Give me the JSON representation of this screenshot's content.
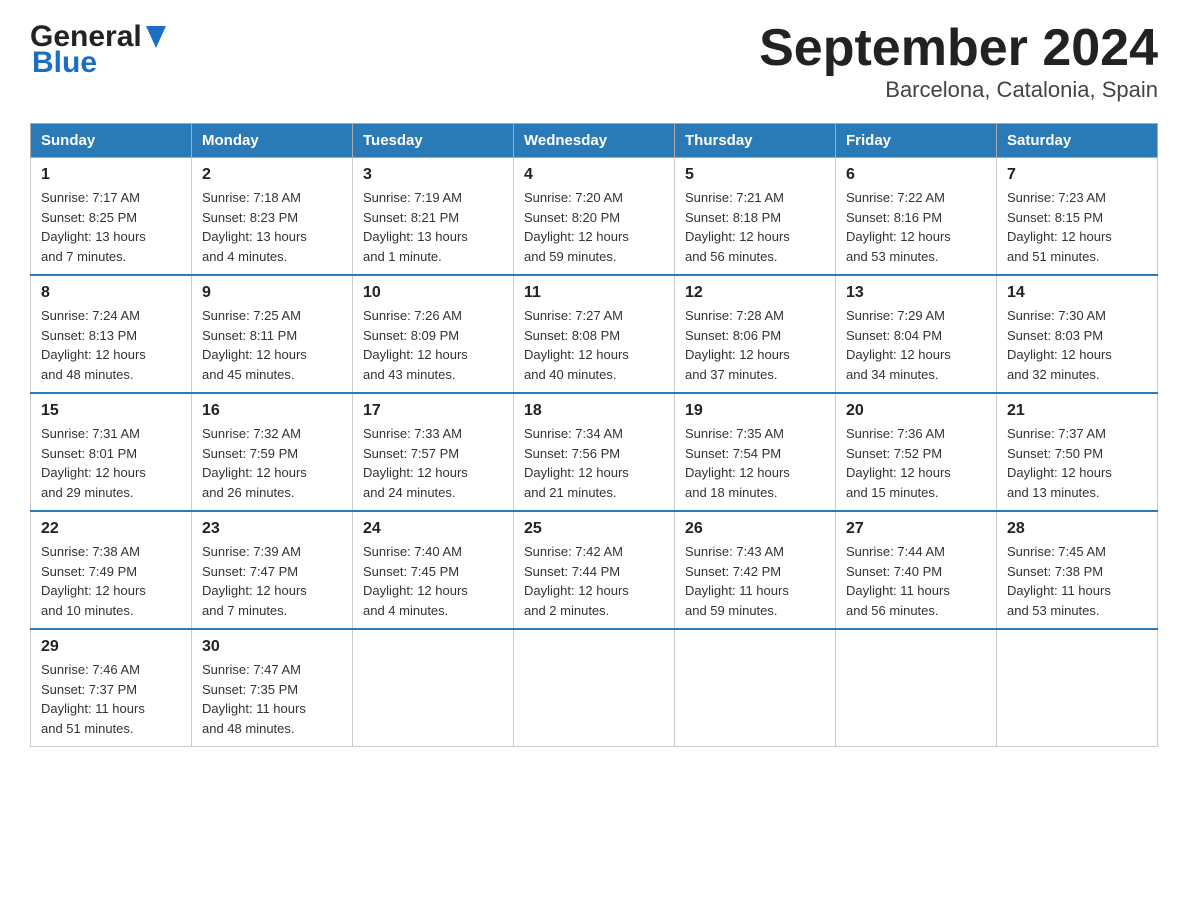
{
  "header": {
    "logo_general": "General",
    "logo_blue": "Blue",
    "title": "September 2024",
    "subtitle": "Barcelona, Catalonia, Spain"
  },
  "days_of_week": [
    "Sunday",
    "Monday",
    "Tuesday",
    "Wednesday",
    "Thursday",
    "Friday",
    "Saturday"
  ],
  "weeks": [
    [
      {
        "num": "1",
        "info": "Sunrise: 7:17 AM\nSunset: 8:25 PM\nDaylight: 13 hours\nand 7 minutes."
      },
      {
        "num": "2",
        "info": "Sunrise: 7:18 AM\nSunset: 8:23 PM\nDaylight: 13 hours\nand 4 minutes."
      },
      {
        "num": "3",
        "info": "Sunrise: 7:19 AM\nSunset: 8:21 PM\nDaylight: 13 hours\nand 1 minute."
      },
      {
        "num": "4",
        "info": "Sunrise: 7:20 AM\nSunset: 8:20 PM\nDaylight: 12 hours\nand 59 minutes."
      },
      {
        "num": "5",
        "info": "Sunrise: 7:21 AM\nSunset: 8:18 PM\nDaylight: 12 hours\nand 56 minutes."
      },
      {
        "num": "6",
        "info": "Sunrise: 7:22 AM\nSunset: 8:16 PM\nDaylight: 12 hours\nand 53 minutes."
      },
      {
        "num": "7",
        "info": "Sunrise: 7:23 AM\nSunset: 8:15 PM\nDaylight: 12 hours\nand 51 minutes."
      }
    ],
    [
      {
        "num": "8",
        "info": "Sunrise: 7:24 AM\nSunset: 8:13 PM\nDaylight: 12 hours\nand 48 minutes."
      },
      {
        "num": "9",
        "info": "Sunrise: 7:25 AM\nSunset: 8:11 PM\nDaylight: 12 hours\nand 45 minutes."
      },
      {
        "num": "10",
        "info": "Sunrise: 7:26 AM\nSunset: 8:09 PM\nDaylight: 12 hours\nand 43 minutes."
      },
      {
        "num": "11",
        "info": "Sunrise: 7:27 AM\nSunset: 8:08 PM\nDaylight: 12 hours\nand 40 minutes."
      },
      {
        "num": "12",
        "info": "Sunrise: 7:28 AM\nSunset: 8:06 PM\nDaylight: 12 hours\nand 37 minutes."
      },
      {
        "num": "13",
        "info": "Sunrise: 7:29 AM\nSunset: 8:04 PM\nDaylight: 12 hours\nand 34 minutes."
      },
      {
        "num": "14",
        "info": "Sunrise: 7:30 AM\nSunset: 8:03 PM\nDaylight: 12 hours\nand 32 minutes."
      }
    ],
    [
      {
        "num": "15",
        "info": "Sunrise: 7:31 AM\nSunset: 8:01 PM\nDaylight: 12 hours\nand 29 minutes."
      },
      {
        "num": "16",
        "info": "Sunrise: 7:32 AM\nSunset: 7:59 PM\nDaylight: 12 hours\nand 26 minutes."
      },
      {
        "num": "17",
        "info": "Sunrise: 7:33 AM\nSunset: 7:57 PM\nDaylight: 12 hours\nand 24 minutes."
      },
      {
        "num": "18",
        "info": "Sunrise: 7:34 AM\nSunset: 7:56 PM\nDaylight: 12 hours\nand 21 minutes."
      },
      {
        "num": "19",
        "info": "Sunrise: 7:35 AM\nSunset: 7:54 PM\nDaylight: 12 hours\nand 18 minutes."
      },
      {
        "num": "20",
        "info": "Sunrise: 7:36 AM\nSunset: 7:52 PM\nDaylight: 12 hours\nand 15 minutes."
      },
      {
        "num": "21",
        "info": "Sunrise: 7:37 AM\nSunset: 7:50 PM\nDaylight: 12 hours\nand 13 minutes."
      }
    ],
    [
      {
        "num": "22",
        "info": "Sunrise: 7:38 AM\nSunset: 7:49 PM\nDaylight: 12 hours\nand 10 minutes."
      },
      {
        "num": "23",
        "info": "Sunrise: 7:39 AM\nSunset: 7:47 PM\nDaylight: 12 hours\nand 7 minutes."
      },
      {
        "num": "24",
        "info": "Sunrise: 7:40 AM\nSunset: 7:45 PM\nDaylight: 12 hours\nand 4 minutes."
      },
      {
        "num": "25",
        "info": "Sunrise: 7:42 AM\nSunset: 7:44 PM\nDaylight: 12 hours\nand 2 minutes."
      },
      {
        "num": "26",
        "info": "Sunrise: 7:43 AM\nSunset: 7:42 PM\nDaylight: 11 hours\nand 59 minutes."
      },
      {
        "num": "27",
        "info": "Sunrise: 7:44 AM\nSunset: 7:40 PM\nDaylight: 11 hours\nand 56 minutes."
      },
      {
        "num": "28",
        "info": "Sunrise: 7:45 AM\nSunset: 7:38 PM\nDaylight: 11 hours\nand 53 minutes."
      }
    ],
    [
      {
        "num": "29",
        "info": "Sunrise: 7:46 AM\nSunset: 7:37 PM\nDaylight: 11 hours\nand 51 minutes."
      },
      {
        "num": "30",
        "info": "Sunrise: 7:47 AM\nSunset: 7:35 PM\nDaylight: 11 hours\nand 48 minutes."
      },
      {
        "num": "",
        "info": ""
      },
      {
        "num": "",
        "info": ""
      },
      {
        "num": "",
        "info": ""
      },
      {
        "num": "",
        "info": ""
      },
      {
        "num": "",
        "info": ""
      }
    ]
  ]
}
